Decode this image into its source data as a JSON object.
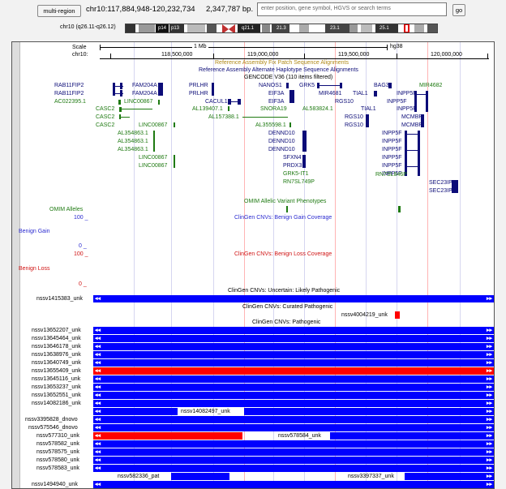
{
  "nav": {
    "multi_region_label": "multi-region",
    "position": "chr10:117,884,948-120,232,734",
    "size": "2,347,787 bp.",
    "search_placeholder": "enter position, gene symbol, HGVS or search terms",
    "go_label": "go"
  },
  "ideogram": {
    "label": "chr10 (q26.11-q26.12)",
    "bands": [
      "p14",
      "p13",
      "q21.1",
      "21.3",
      "23.1",
      "25.1"
    ]
  },
  "ruler": {
    "scale_label": "Scale",
    "chrom_label": "chr10:",
    "scale_value": "1 Mb",
    "assembly": "hg38",
    "ticks": [
      "118,500,000",
      "119,000,000",
      "119,500,000",
      "120,000,000"
    ]
  },
  "tracks": {
    "fix_patch": "Reference Assembly Fix Patch Sequence Alignments",
    "alt_haplo": "Reference Assembly Alternate Haplotype Sequence Alignments",
    "gencode": "GENCODE V36 (110 items filtered)",
    "omim_label": "OMIM Alleles",
    "omim_title": "OMIM Allelic Variant Phenotypes",
    "benign_gain": {
      "max": "100 _",
      "label": "Benign Gain",
      "min": "0 _",
      "title": "ClinGen CNVs: Benign Gain Coverage"
    },
    "benign_loss": {
      "max": "100 _",
      "label": "Benign Loss",
      "min": "0 _",
      "title": "ClinGen CNVs: Benign Loss Coverage"
    },
    "uncertain_title": "ClinGen CNVs: Uncertain: Likely Pathogenic",
    "curated_title": "ClinGen CNVs: Curated Pathogenic",
    "pathogenic_title": "ClinGen CNVs: Pathogenic"
  },
  "genes": {
    "rab1": "RAB11FIP2",
    "rab2": "RAB11FIP2",
    "ac02": "AC022395.1",
    "casc1": "CASC2",
    "casc2": "CASC2",
    "casc3": "CASC2",
    "fam1": "FAM204A",
    "fam2": "FAM204A",
    "linc1": "LINC00867",
    "linc2": "LINC00867",
    "linc3": "LINC00867",
    "linc4": "LINC00867",
    "al1": "AL354863.1",
    "al2": "AL354863.1",
    "al3": "AL354863.1",
    "prlhr1": "PRLHR",
    "prlhr2": "PRLHR",
    "cacul1": "CACUL1",
    "al139": "AL139407.1",
    "al157": "AL157388.1",
    "nanos1": "NANOS1",
    "eif3a1": "EIF3A",
    "eif3a2": "EIF3A",
    "snora19": "SNORA19",
    "al355": "AL355598.1",
    "dennd1": "DENND10",
    "dennd2": "DENND10",
    "dennd3": "DENND10",
    "sfxn4": "SFXN4",
    "prdx3": "PRDX3",
    "grk5it1": "GRK5-IT1",
    "rn7sl749": "RN7SL749P",
    "grk5": "GRK5",
    "mir4681": "MIR4681",
    "rgs10a": "RGS10",
    "rgs10b": "RGS10",
    "rgs10c": "RGS10",
    "al583": "AL583824.1",
    "tial1a": "TIAL1",
    "tial1b": "TIAL1",
    "bag3": "BAG3",
    "mir4682": "MIR4682",
    "inpp1": "INPP5F",
    "inpp2": "INPP5F",
    "inpp3": "INPP5F",
    "inpp4": "INPP5F",
    "inpp5": "INPP5F",
    "inpp6": "INPP5F",
    "inpp7": "INPP5F",
    "inpp8": "INPP5F",
    "inpp9": "INPP5F",
    "mcmbp1": "MCMBP",
    "mcmbp2": "MCMBP",
    "rn7sl846": "RN7SL846P",
    "sec1": "SEC23IP",
    "sec2": "SEC23IP"
  },
  "cnv_rows": [
    {
      "label": "nssv1415383_unk",
      "section": "uncertain"
    },
    {
      "label": "nssv4004219_unk",
      "section": "curated"
    },
    {
      "label": "nssv13652207_unk",
      "section": "pathogenic"
    },
    {
      "label": "nssv13645464_unk",
      "section": "pathogenic"
    },
    {
      "label": "nssv13646178_unk",
      "section": "pathogenic"
    },
    {
      "label": "nssv13638976_unk",
      "section": "pathogenic"
    },
    {
      "label": "nssv13640749_unk",
      "section": "pathogenic"
    },
    {
      "label": "nssv13655409_unk",
      "section": "pathogenic"
    },
    {
      "label": "nssv13645116_unk",
      "section": "pathogenic"
    },
    {
      "label": "nssv13653237_unk",
      "section": "pathogenic"
    },
    {
      "label": "nssv13652551_unk",
      "section": "pathogenic"
    },
    {
      "label": "nssv14082186_unk",
      "section": "pathogenic"
    },
    {
      "label": "nssv14082497_unk",
      "section": "pathogenic"
    },
    {
      "label": "nssv3395828_dnovo",
      "section": "pathogenic"
    },
    {
      "label": "nssv575546_dnovo",
      "section": "pathogenic"
    },
    {
      "label": "nssv577310_unk",
      "section": "pathogenic"
    },
    {
      "label": "nssv578584_unk",
      "section": "pathogenic"
    },
    {
      "label": "nssv578582_unk",
      "section": "pathogenic"
    },
    {
      "label": "nssv578575_unk",
      "section": "pathogenic"
    },
    {
      "label": "nssv578580_unk",
      "section": "pathogenic"
    },
    {
      "label": "nssv578583_unk",
      "section": "pathogenic"
    },
    {
      "label": "nssv582336_pat",
      "section": "pathogenic"
    },
    {
      "label": "nssv3397337_unk",
      "section": "pathogenic"
    },
    {
      "label": "nssv1494940_unk",
      "section": "pathogenic"
    }
  ],
  "colors": {
    "gain": "#0000ff",
    "loss": "#ff0000",
    "coding": "#0c0c78",
    "noncoding": "#1f7a12"
  }
}
